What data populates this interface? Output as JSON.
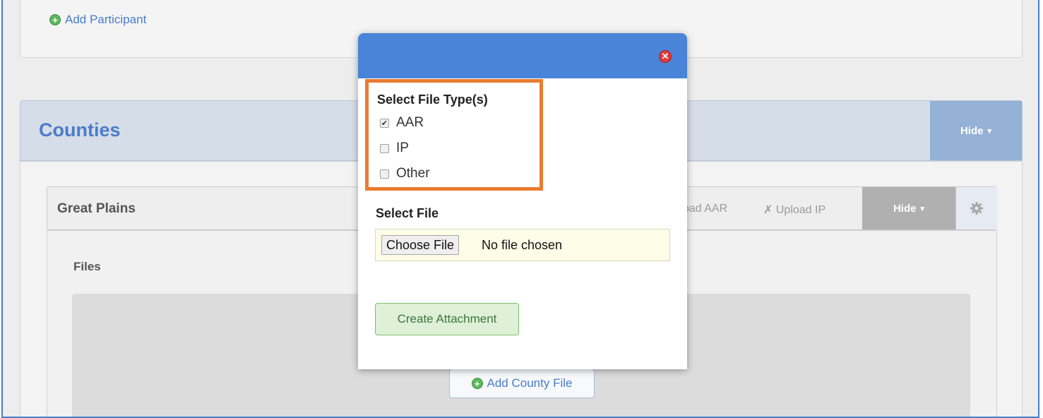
{
  "participants": {
    "add_label": "Add Participant"
  },
  "counties": {
    "title": "Counties",
    "hide_label": "Hide",
    "caret": "▾"
  },
  "county": {
    "name": "Great Plains",
    "upload_aar": "oad AAR",
    "upload_ip": "Upload IP",
    "upload_ip_mark": "✗",
    "hide_label": "Hide",
    "caret": "▾",
    "files_label": "Files",
    "add_file_label": "Add County File"
  },
  "modal": {
    "close_symbol": "✕",
    "file_types_title": "Select File Type(s)",
    "file_types": [
      {
        "label": "AAR",
        "checked": true
      },
      {
        "label": "IP",
        "checked": false
      },
      {
        "label": "Other",
        "checked": false
      }
    ],
    "select_file_title": "Select File",
    "choose_file_label": "Choose File",
    "no_file_text": "No file chosen",
    "create_label": "Create Attachment",
    "check_mark": "✔"
  },
  "colors": {
    "accent": "#4a84d8",
    "highlight": "#ea7c2f",
    "success": "#5cb85c"
  }
}
